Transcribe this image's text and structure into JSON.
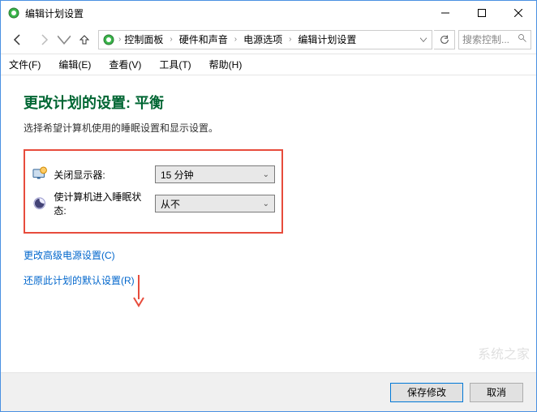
{
  "window": {
    "title": "编辑计划设置"
  },
  "breadcrumb": {
    "items": [
      "控制面板",
      "硬件和声音",
      "电源选项",
      "编辑计划设置"
    ]
  },
  "search": {
    "placeholder": "搜索控制..."
  },
  "menu": {
    "items": [
      "文件(F)",
      "编辑(E)",
      "查看(V)",
      "工具(T)",
      "帮助(H)"
    ]
  },
  "page": {
    "title": "更改计划的设置: 平衡",
    "description": "选择希望计算机使用的睡眠设置和显示设置。"
  },
  "settings": {
    "display_off": {
      "label": "关闭显示器:",
      "value": "15 分钟"
    },
    "sleep": {
      "label": "使计算机进入睡眠状态:",
      "value": "从不"
    }
  },
  "links": {
    "advanced": "更改高级电源设置(C)",
    "restore": "还原此计划的默认设置(R)"
  },
  "footer": {
    "save": "保存修改",
    "cancel": "取消"
  },
  "watermark": "系统之家"
}
